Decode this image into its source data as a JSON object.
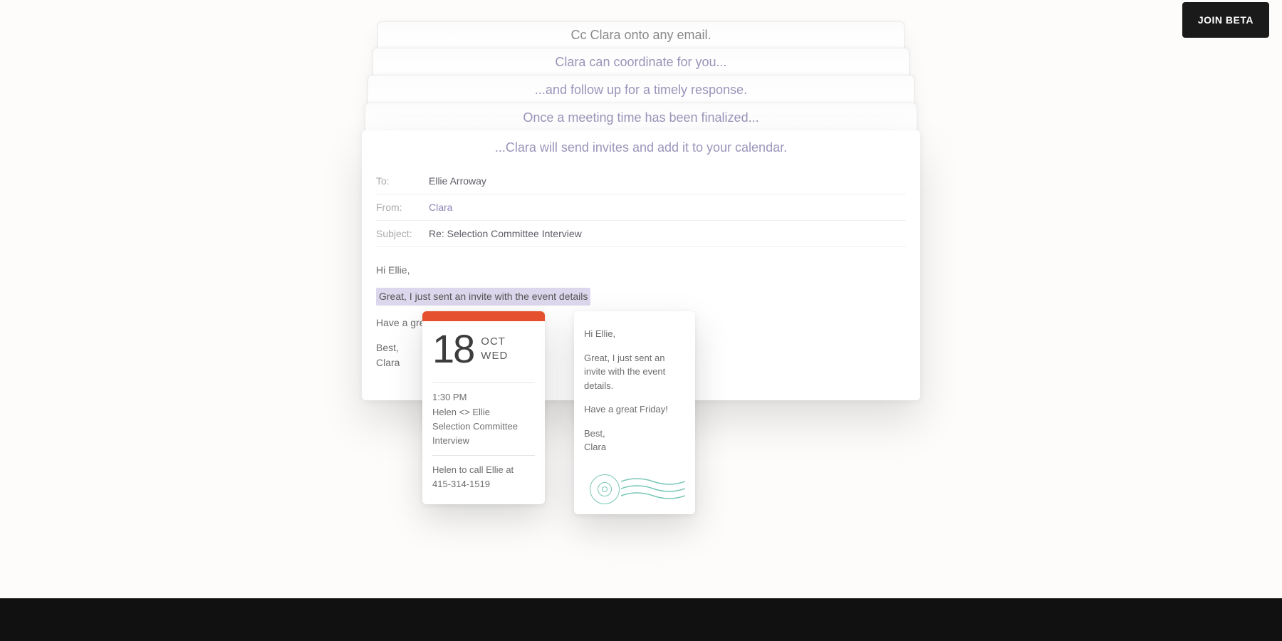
{
  "cta": {
    "join_beta": "JOIN BETA"
  },
  "strips": {
    "s1": "Cc Clara onto any email.",
    "s2": "Clara can coordinate for you...",
    "s3": "...and follow up for a timely response.",
    "s4": "Once a meeting time has been finalized..."
  },
  "email": {
    "tagline": "...Clara will send invites and add it to your calendar.",
    "to_label": "To:",
    "to_value": "Ellie Arroway",
    "from_label": "From:",
    "from_value": "Clara",
    "subject_label": "Subject:",
    "subject_value": "Re: Selection Committee Interview",
    "greeting": "Hi Ellie,",
    "highlight": "Great, I just sent an invite with the event details",
    "line2": "Have a great Friday!",
    "signoff1": "Best,",
    "signoff2": "Clara"
  },
  "calendar": {
    "accent": "#e5512f",
    "day_number": "18",
    "month": "OCT",
    "weekday": "WED",
    "time": "1:30 PM",
    "title_line1": "Helen <> Ellie",
    "title_line2": "Selection Committee Interview",
    "detail_line1": "Helen to call Ellie at",
    "detail_phone": "415-314-1519"
  },
  "note": {
    "greeting": "Hi Ellie,",
    "body": "Great, I just sent an invite with the event details.",
    "line2": "Have a great Friday!",
    "signoff1": "Best,",
    "signoff2": "Clara",
    "stamp_color": "#79c7b6"
  }
}
